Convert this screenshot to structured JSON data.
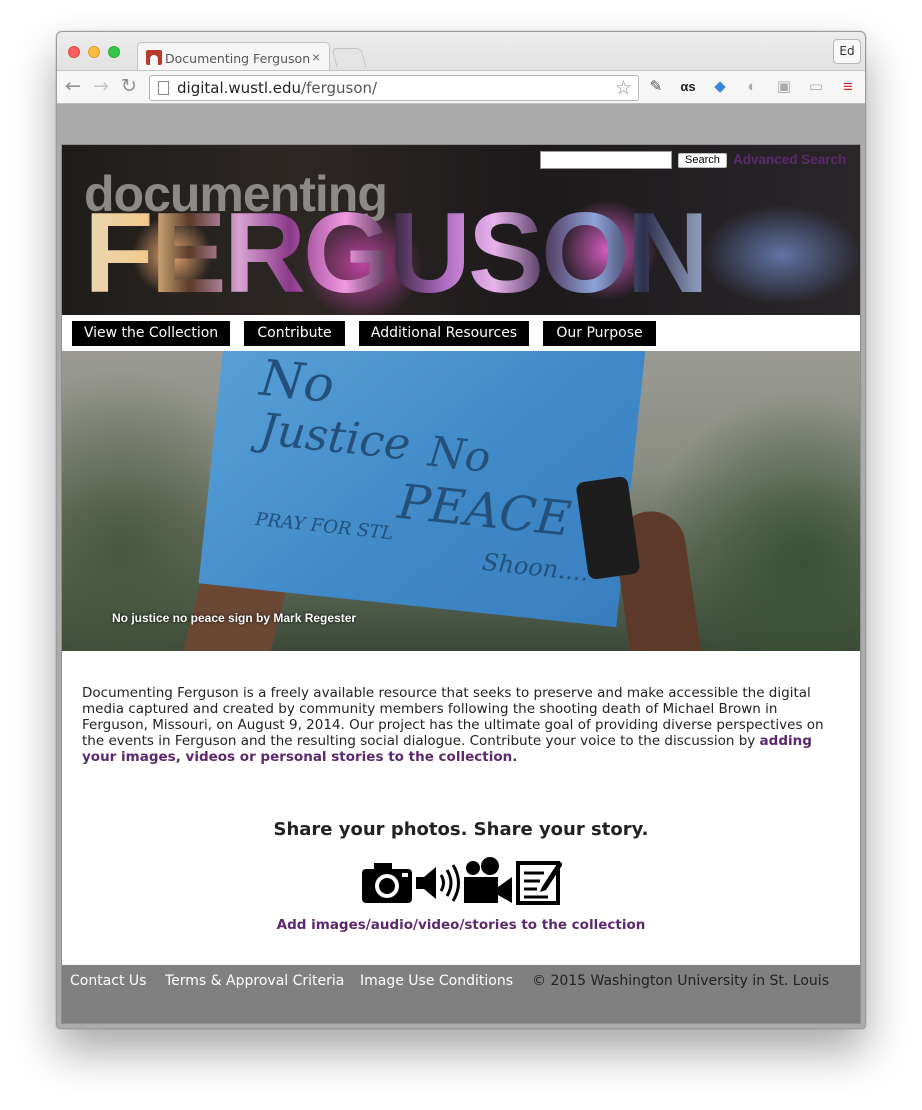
{
  "browser": {
    "tab_title": "Documenting Ferguson",
    "tab_close": "×",
    "profile": "Ed",
    "url_host": "digital.wustl.edu",
    "url_path": "/ferguson/"
  },
  "header": {
    "title_small": "documenting",
    "title_big": "FERGUSON",
    "search_button": "Search",
    "advanced_search": "Advanced Search"
  },
  "nav": {
    "items": [
      "View the Collection",
      "Contribute",
      "Additional Resources",
      "Our Purpose"
    ]
  },
  "hero": {
    "caption": "No justice no peace sign by Mark Regester",
    "sign_lines": [
      "No",
      "Justice",
      "No",
      "PEACE",
      "Shoon....",
      "PRAY FOR STL"
    ]
  },
  "intro": {
    "text": "Documenting Ferguson is a freely available resource that seeks to preserve and make accessible the digital media captured and created by community members following the shooting death of Michael Brown in Ferguson, Missouri, on August 9, 2014. Our project has the ultimate goal of providing diverse perspectives on the events in Ferguson and the resulting social dialogue. Contribute your voice to the discussion by ",
    "link": "adding your images, videos or personal stories to the collection."
  },
  "share": {
    "heading": "Share your photos. Share your story.",
    "icons": [
      "camera-icon",
      "speaker-icon",
      "video-camera-icon",
      "document-edit-icon"
    ],
    "link": "Add images/audio/video/stories to the collection"
  },
  "footer": {
    "links": [
      "Contact Us",
      "Terms & Approval Criteria",
      "Image Use Conditions"
    ],
    "copyright": "© 2015 Washington University in St. Louis"
  },
  "colors": {
    "accent_purple": "#5c2a6c",
    "nav_bg": "#000000",
    "footer_bg": "#808080"
  }
}
